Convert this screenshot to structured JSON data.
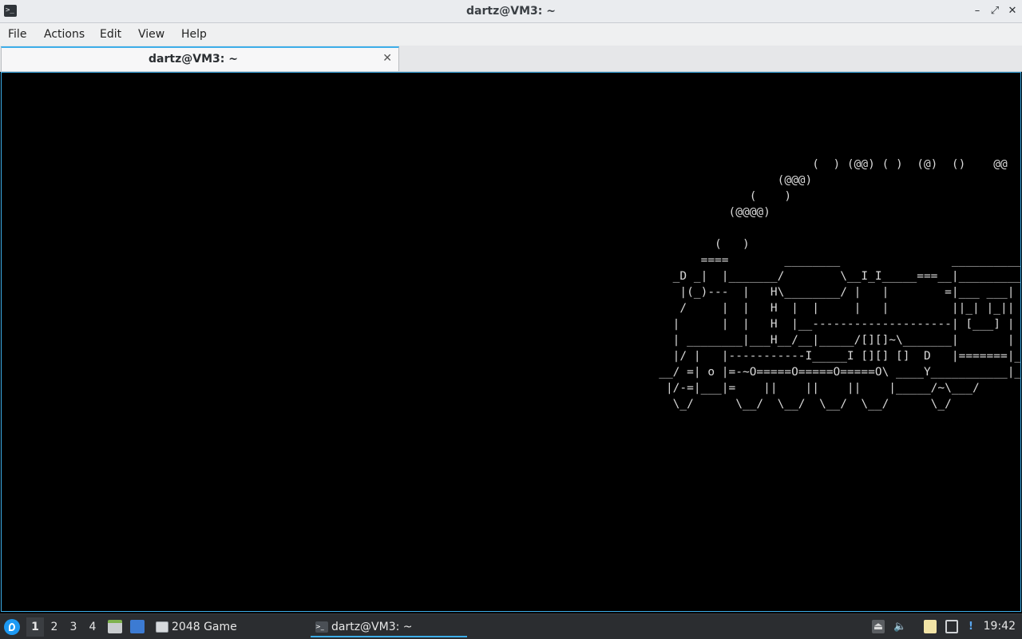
{
  "window": {
    "title": "dartz@VM3: ~"
  },
  "menu": [
    "File",
    "Actions",
    "Edit",
    "View",
    "Help"
  ],
  "tabs": [
    {
      "label": "dartz@VM3: ~",
      "active": true
    }
  ],
  "terminal": {
    "ascii_art": "                                    (  ) (@@) ( )  (@)  ()    @@\n                               (@@@)\n                           (    )\n                        (@@@@)\n\n                      (   )\n                    ====        ________                ___________\n                _D _|  |_______/        \\__I_I_____===__|_________|\n                 |(_)---  |   H\\________/ |   |        =|___ ___|\n                 /     |  |   H  |  |     |   |         ||_| |_||\n                |      |  |   H  |__--------------------| [___] |   =\n                | ________|___H__/__|_____/[][]~\\_______|       |   -\n                |/ |   |-----------I_____I [][] []  D   |=======|____\n              __/ =| o |=-~O=====O=====O=====O\\ ____Y___________|__|_\n               |/-=|___|=    ||    ||    ||    |_____/~\\___/\n                \\_/      \\__/  \\__/  \\__/  \\__/      \\_/"
  },
  "taskbar": {
    "workspaces": [
      "1",
      "2",
      "3",
      "4"
    ],
    "active_workspace": "1",
    "tasks": [
      {
        "label": "2048 Game",
        "icon": "window-icon"
      },
      {
        "label": "dartz@VM3: ~",
        "icon": "terminal-icon",
        "active": true
      }
    ],
    "tray_icons": [
      "eject-icon",
      "volume-icon",
      "clipboard-icon",
      "network-icon",
      "update-notifier-icon"
    ],
    "clock": "19:42"
  },
  "colors": {
    "accent": "#3daee9",
    "terminal_bg": "#000000",
    "terminal_fg": "#d8d8d8",
    "taskbar_bg": "#2b2d30"
  }
}
